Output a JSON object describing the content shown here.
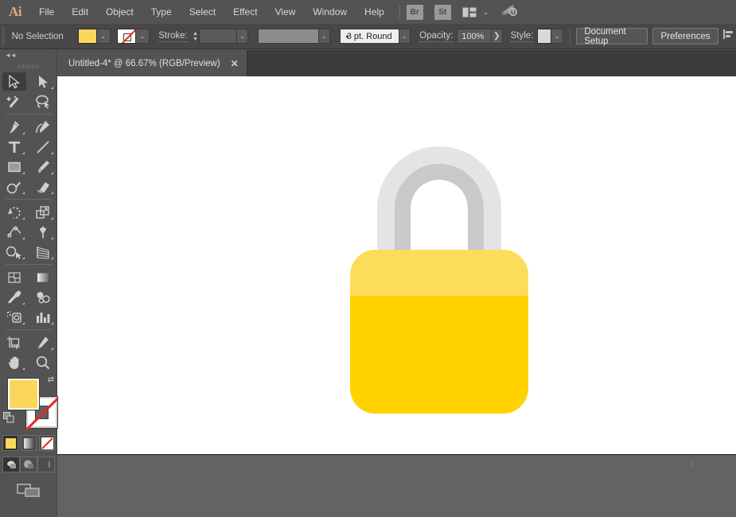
{
  "app": {
    "logo": "Ai",
    "name": "Adobe Illustrator"
  },
  "menubar": {
    "items": [
      {
        "label": "File"
      },
      {
        "label": "Edit"
      },
      {
        "label": "Object"
      },
      {
        "label": "Type"
      },
      {
        "label": "Select"
      },
      {
        "label": "Effect"
      },
      {
        "label": "View"
      },
      {
        "label": "Window"
      },
      {
        "label": "Help"
      }
    ],
    "bridge_badge": "Br",
    "stock_badge": "St",
    "arrange_icon": "arrange-documents-icon",
    "arrange_chevron": "⌄",
    "rocket_icon": "home-rocket-icon"
  },
  "controlbar": {
    "selection_status": "No Selection",
    "fill_label": "Fill",
    "fill_color": "#FAD75C",
    "fill_chevron": "⌄",
    "stroke_swatch_label": "Stroke color (None)",
    "stroke_chevron": "⌄",
    "stroke_label": "Stroke:",
    "stroke_weight": "",
    "stroke_weight_chevron": "⌄",
    "variable_width_profile": "Uniform",
    "profile_chevron": "⌄",
    "brush_definition": "3 pt. Round",
    "brush_chevron": "⌄",
    "opacity_label": "Opacity:",
    "opacity_value": "100%",
    "opacity_arrow": "❯",
    "style_label": "Style:",
    "style_chevron": "⌄",
    "document_setup_button": "Document Setup",
    "preferences_button": "Preferences",
    "align_icon": "align-panel-icon"
  },
  "tabbar": {
    "tab_title": "Untitled-4* @ 66.67% (RGB/Preview)",
    "close_icon": "✕"
  },
  "toolbar": {
    "collapse_icon": "◄◄",
    "tools": [
      {
        "name": "selection-tool",
        "label": "Selection",
        "active": true,
        "corner": false
      },
      {
        "name": "direct-selection-tool",
        "label": "Direct Selection",
        "active": false,
        "corner": true
      },
      {
        "name": "magic-wand-tool",
        "label": "Magic Wand",
        "active": false,
        "corner": false
      },
      {
        "name": "lasso-tool",
        "label": "Lasso",
        "active": false,
        "corner": false
      },
      {
        "name": "pen-tool",
        "label": "Pen",
        "active": false,
        "corner": true
      },
      {
        "name": "curvature-tool",
        "label": "Curvature",
        "active": false,
        "corner": false
      },
      {
        "name": "type-tool",
        "label": "Type",
        "active": false,
        "corner": true
      },
      {
        "name": "line-segment-tool",
        "label": "Line Segment",
        "active": false,
        "corner": true
      },
      {
        "name": "rectangle-tool",
        "label": "Rectangle",
        "active": false,
        "corner": true
      },
      {
        "name": "paintbrush-tool",
        "label": "Paintbrush",
        "active": false,
        "corner": true
      },
      {
        "name": "shaper-tool",
        "label": "Shaper",
        "active": false,
        "corner": true
      },
      {
        "name": "eraser-tool",
        "label": "Eraser",
        "active": false,
        "corner": true
      },
      {
        "name": "rotate-tool",
        "label": "Rotate",
        "active": false,
        "corner": true
      },
      {
        "name": "scale-tool",
        "label": "Scale",
        "active": false,
        "corner": true
      },
      {
        "name": "width-tool",
        "label": "Width",
        "active": false,
        "corner": true
      },
      {
        "name": "free-transform-tool",
        "label": "Free Transform",
        "active": false,
        "corner": true
      },
      {
        "name": "shape-builder-tool",
        "label": "Shape Builder",
        "active": false,
        "corner": true
      },
      {
        "name": "perspective-grid-tool",
        "label": "Perspective Grid",
        "active": false,
        "corner": true
      },
      {
        "name": "mesh-tool",
        "label": "Mesh",
        "active": false,
        "corner": false
      },
      {
        "name": "gradient-tool",
        "label": "Gradient",
        "active": false,
        "corner": false
      },
      {
        "name": "eyedropper-tool",
        "label": "Eyedropper",
        "active": false,
        "corner": true
      },
      {
        "name": "blend-tool",
        "label": "Blend",
        "active": false,
        "corner": false
      },
      {
        "name": "symbol-sprayer-tool",
        "label": "Symbol Sprayer",
        "active": false,
        "corner": true
      },
      {
        "name": "column-graph-tool",
        "label": "Column Graph",
        "active": false,
        "corner": true
      },
      {
        "name": "artboard-tool",
        "label": "Artboard",
        "active": false,
        "corner": false
      },
      {
        "name": "slice-tool",
        "label": "Slice",
        "active": false,
        "corner": true
      },
      {
        "name": "hand-tool",
        "label": "Hand",
        "active": false,
        "corner": true
      },
      {
        "name": "zoom-tool",
        "label": "Zoom",
        "active": false,
        "corner": false
      }
    ],
    "fill_swatch_color": "#FAD75C",
    "stroke_swatch_label": "None",
    "swap_icon": "⇄",
    "default_fill_stroke_icon": "default-fill-stroke-icon",
    "color_modes": [
      {
        "name": "color-swatch-button",
        "label": "Color",
        "active": true
      },
      {
        "name": "gradient-button",
        "label": "Gradient",
        "active": false
      },
      {
        "name": "none-button",
        "label": "None",
        "active": false
      }
    ],
    "draw_modes": [
      {
        "name": "draw-normal-button",
        "label": "Draw Normal",
        "active": true
      },
      {
        "name": "draw-behind-button",
        "label": "Draw Behind",
        "active": false
      },
      {
        "name": "draw-inside-button",
        "label": "Draw Inside",
        "active": false
      }
    ],
    "screen_mode": {
      "name": "change-screen-mode-button",
      "label": "Change Screen Mode"
    }
  },
  "canvas": {
    "background_color": "#636363",
    "artboard_color": "#FFFFFF",
    "zoom_level": "66.67%",
    "color_mode": "RGB",
    "view_mode": "Preview",
    "artwork": {
      "name": "padlock-illustration",
      "description": "Yellow padlock with gray shackle",
      "body_color": "#FFD200",
      "body_top_color": "#FCDC5A",
      "shackle_outer_color": "#E4E4E6",
      "shackle_inner_color": "#C9C9CC"
    }
  }
}
